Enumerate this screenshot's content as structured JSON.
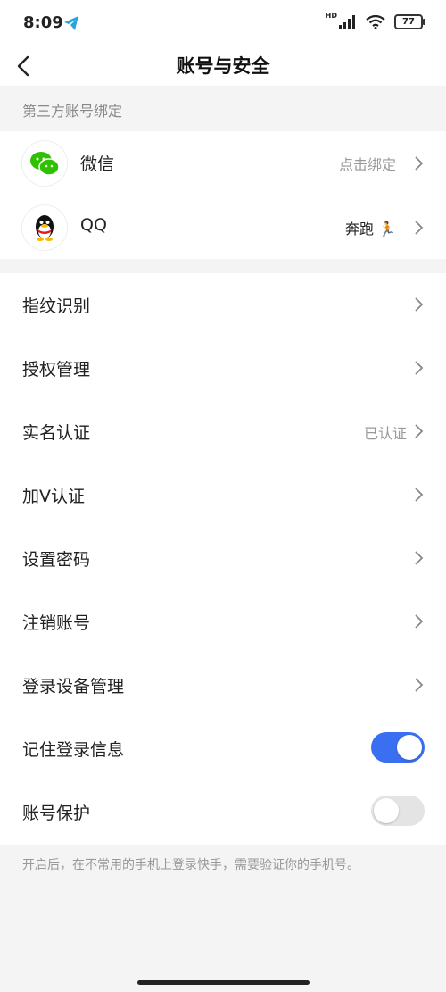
{
  "status_bar": {
    "time": "8:09",
    "battery": "77",
    "network": "HD"
  },
  "nav": {
    "title": "账号与安全"
  },
  "third_party": {
    "header": "第三方账号绑定",
    "items": [
      {
        "name": "微信",
        "status": "点击绑定"
      },
      {
        "name": "QQ",
        "status": "奔跑 🏃"
      }
    ]
  },
  "settings": {
    "items": [
      {
        "label": "指纹识别",
        "value": ""
      },
      {
        "label": "授权管理",
        "value": ""
      },
      {
        "label": "实名认证",
        "value": "已认证"
      },
      {
        "label": "加V认证",
        "value": ""
      },
      {
        "label": "设置密码",
        "value": ""
      },
      {
        "label": "注销账号",
        "value": ""
      },
      {
        "label": "登录设备管理",
        "value": ""
      }
    ],
    "toggles": [
      {
        "label": "记住登录信息",
        "on": true
      },
      {
        "label": "账号保护",
        "on": false
      }
    ]
  },
  "footnote": "开启后，在不常用的手机上登录快手，需要验证你的手机号。",
  "colors": {
    "accent": "#3a6ff2",
    "wechat": "#2dc100"
  }
}
